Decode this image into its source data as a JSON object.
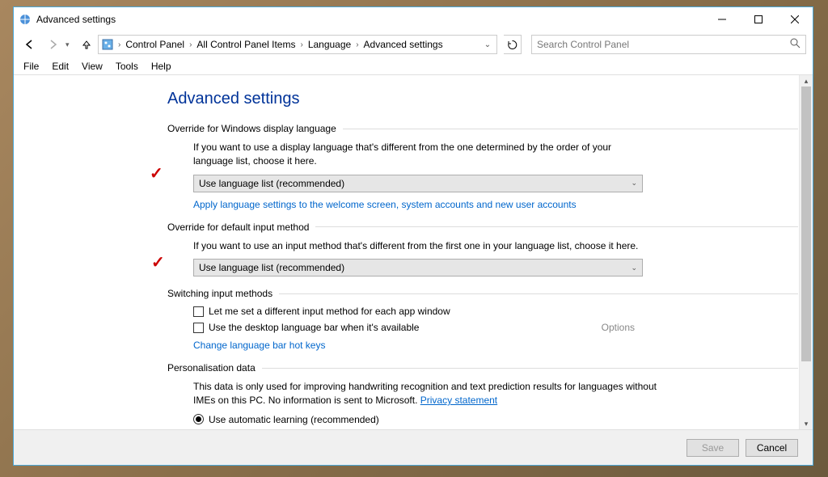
{
  "window": {
    "title": "Advanced settings"
  },
  "breadcrumb": {
    "items": [
      "Control Panel",
      "All Control Panel Items",
      "Language",
      "Advanced settings"
    ]
  },
  "search": {
    "placeholder": "Search Control Panel"
  },
  "menu": {
    "file": "File",
    "edit": "Edit",
    "view": "View",
    "tools": "Tools",
    "help": "Help"
  },
  "page": {
    "title": "Advanced settings"
  },
  "sec1": {
    "head": "Override for Windows display language",
    "desc": "If you want to use a display language that's different from the one determined by the order of your language list, choose it here.",
    "dropdown": "Use language list (recommended)",
    "link": "Apply language settings to the welcome screen, system accounts and new user accounts"
  },
  "sec2": {
    "head": "Override for default input method",
    "desc": "If you want to use an input method that's different from the first one in your language list, choose it here.",
    "dropdown": "Use language list (recommended)"
  },
  "sec3": {
    "head": "Switching input methods",
    "chk1": "Let me set a different input method for each app window",
    "chk2": "Use the desktop language bar when it's available",
    "options": "Options",
    "link": "Change language bar hot keys"
  },
  "sec4": {
    "head": "Personalisation data",
    "desc_a": "This data is only used for improving handwriting recognition and text prediction results for languages without IMEs on this PC. No information is sent to Microsoft. ",
    "privacy": "Privacy statement",
    "radio1": "Use automatic learning (recommended)"
  },
  "footer": {
    "save": "Save",
    "cancel": "Cancel"
  }
}
